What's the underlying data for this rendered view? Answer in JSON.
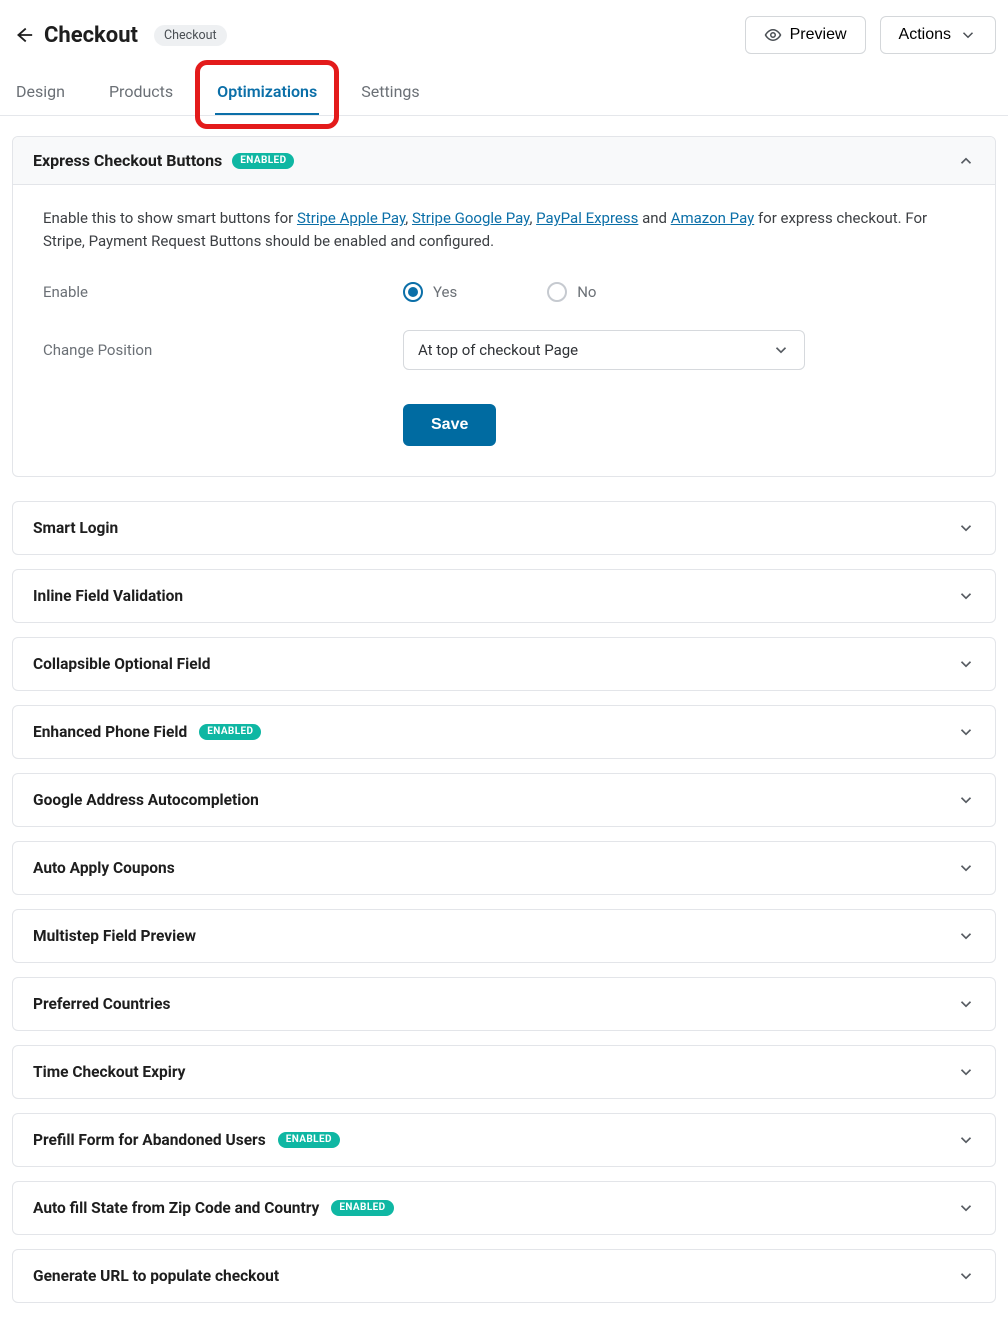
{
  "header": {
    "title": "Checkout",
    "chip": "Checkout",
    "preview": "Preview",
    "actions": "Actions"
  },
  "tabs": {
    "design": "Design",
    "products": "Products",
    "optimizations": "Optimizations",
    "settings": "Settings"
  },
  "express_section": {
    "title": "Express Checkout Buttons",
    "badge": "ENABLED",
    "desc_pre": "Enable this to show smart buttons for ",
    "link1": "Stripe Apple Pay",
    "sep1": ", ",
    "link2": "Stripe Google Pay",
    "sep2": ", ",
    "link3": "PayPal Express",
    "sep3": " and ",
    "link4": "Amazon Pay",
    "desc_post": " for express checkout. For Stripe, Payment Request Buttons should be enabled and configured.",
    "enable_label": "Enable",
    "enable_yes": "Yes",
    "enable_no": "No",
    "position_label": "Change Position",
    "position_value": "At top of checkout Page",
    "save": "Save"
  },
  "accordions": [
    {
      "title": "Smart Login",
      "enabled": false
    },
    {
      "title": "Inline Field Validation",
      "enabled": false
    },
    {
      "title": "Collapsible Optional Field",
      "enabled": false
    },
    {
      "title": "Enhanced Phone Field",
      "enabled": true
    },
    {
      "title": "Google Address Autocompletion",
      "enabled": false
    },
    {
      "title": "Auto Apply Coupons",
      "enabled": false
    },
    {
      "title": "Multistep Field Preview",
      "enabled": false
    },
    {
      "title": "Preferred Countries",
      "enabled": false
    },
    {
      "title": "Time Checkout Expiry",
      "enabled": false
    },
    {
      "title": "Prefill Form for Abandoned Users",
      "enabled": true
    },
    {
      "title": "Auto fill State from Zip Code and Country",
      "enabled": true
    },
    {
      "title": "Generate URL to populate checkout",
      "enabled": false
    }
  ],
  "badge_text": "ENABLED"
}
